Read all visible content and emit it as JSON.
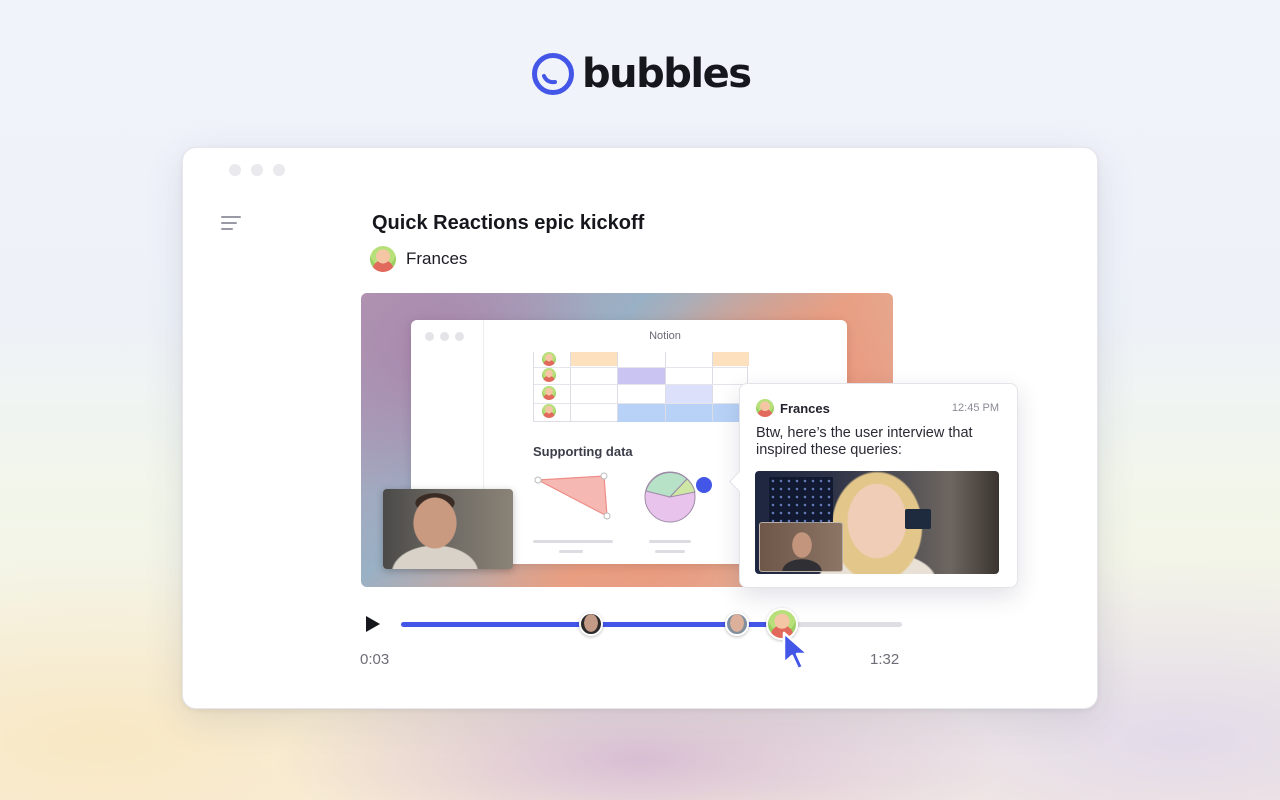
{
  "brand": {
    "name": "bubbles",
    "accent": "#4356e8"
  },
  "window": {
    "menu_icon": "menu-icon",
    "title": "Quick Reactions epic kickoff",
    "author": "Frances"
  },
  "video": {
    "embedded_app_title": "Notion",
    "section_heading": "Supporting data",
    "comment": {
      "author": "Frances",
      "time": "12:45 PM",
      "message": "Btw, here’s the user interview that inspired these queries:"
    }
  },
  "player": {
    "play_icon": "play-icon",
    "current_time": "0:03",
    "duration": "1:32",
    "progress": 0.77,
    "comment_markers": [
      0.38,
      0.67,
      0.76
    ]
  }
}
